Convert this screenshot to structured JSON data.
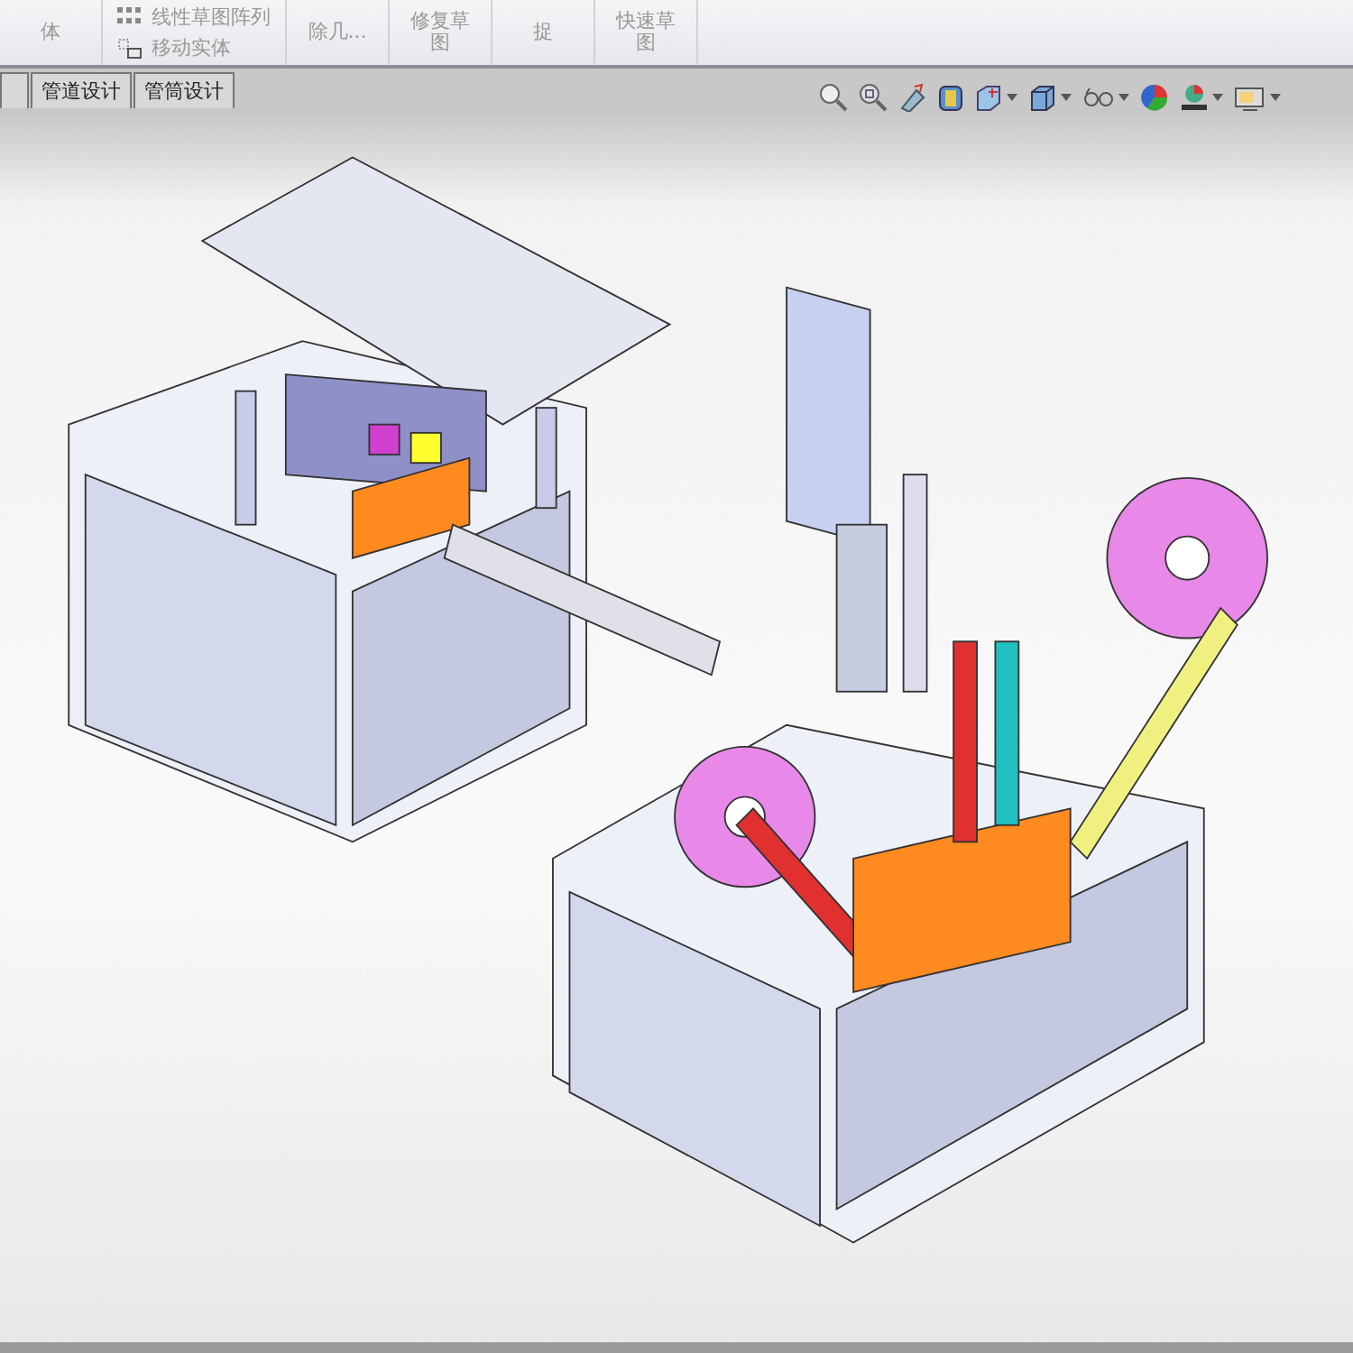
{
  "ribbon": {
    "groups": [
      {
        "items": [
          {
            "label": "体",
            "kind": "big"
          }
        ]
      },
      {
        "items": [
          {
            "label": "线性草图阵列",
            "kind": "small"
          },
          {
            "label": "移动实体",
            "kind": "small"
          }
        ]
      },
      {
        "items": [
          {
            "label": "除几...",
            "kind": "big"
          }
        ]
      },
      {
        "items": [
          {
            "label": "修复草图",
            "kind": "big"
          }
        ]
      },
      {
        "items": [
          {
            "label": "捉",
            "kind": "big"
          }
        ]
      },
      {
        "items": [
          {
            "label": "快速草图",
            "kind": "big"
          }
        ]
      }
    ]
  },
  "tabs": [
    {
      "selected": false
    },
    {
      "label": "管道设计",
      "selected": false
    },
    {
      "label": "管筒设计",
      "selected": false
    }
  ],
  "view_toolbar": [
    {
      "dropdown": false
    },
    {
      "dropdown": false
    },
    {
      "dropdown": false
    },
    {
      "dropdown": false
    },
    {
      "dropdown": true
    },
    {
      "dropdown": true
    },
    {
      "dropdown": true
    },
    {
      "dropdown": false
    },
    {
      "dropdown": true
    },
    {
      "dropdown": true
    }
  ]
}
